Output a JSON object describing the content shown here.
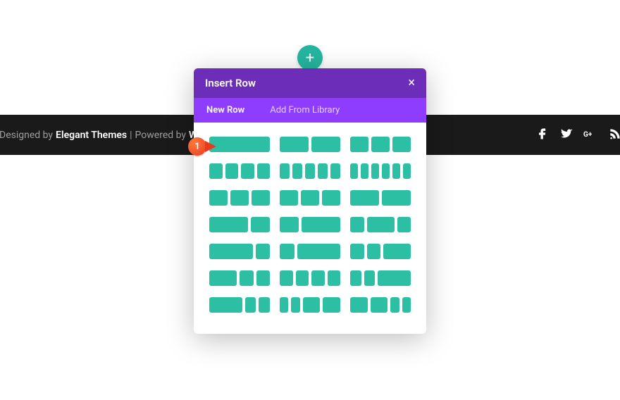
{
  "footer": {
    "designed_prefix": "Designed by ",
    "designed_brand": "Elegant Themes",
    "powered_sep": " | ",
    "powered_prefix": "Powered by ",
    "powered_brand": "WordPr"
  },
  "plus_icon_label": "+",
  "modal": {
    "title": "Insert Row",
    "close": "×",
    "tabs": {
      "new_row": "New Row",
      "add_from_lib": "Add From Library"
    }
  },
  "layouts": [
    [
      1
    ],
    [
      1,
      1
    ],
    [
      1,
      1,
      1
    ],
    [
      1,
      1,
      1,
      1
    ],
    [
      1,
      1,
      1,
      1,
      1
    ],
    [
      1,
      1,
      1,
      1,
      1,
      1
    ],
    [
      2,
      2,
      2
    ],
    [
      2,
      2,
      2
    ],
    [
      1,
      1
    ],
    [
      2,
      1
    ],
    [
      1,
      2
    ],
    [
      1,
      2,
      1
    ],
    [
      3,
      1
    ],
    [
      1,
      3
    ],
    [
      1,
      1,
      2
    ],
    [
      2,
      1,
      1
    ],
    [
      1,
      1,
      1,
      1
    ],
    [
      1,
      1,
      3
    ],
    [
      3,
      1,
      1
    ],
    [
      1,
      1,
      2,
      2
    ],
    [
      2,
      2,
      1,
      1
    ]
  ],
  "marker": {
    "index": "1"
  }
}
